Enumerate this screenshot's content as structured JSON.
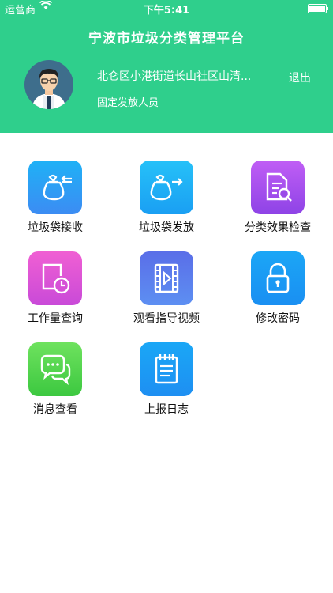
{
  "status": {
    "carrier": "运营商",
    "time": "下午5:41"
  },
  "header": {
    "title": "宁波市垃圾分类管理平台",
    "address": "北仑区小港街道长山社区山清...",
    "role": "固定发放人员",
    "logout": "退出"
  },
  "colors": {
    "header": "#2fcf8c"
  },
  "menu": {
    "items": [
      {
        "label": "垃圾袋接收",
        "icon": "bag-receive-icon"
      },
      {
        "label": "垃圾袋发放",
        "icon": "bag-dispatch-icon"
      },
      {
        "label": "分类效果检查",
        "icon": "document-search-icon"
      },
      {
        "label": "工作量查询",
        "icon": "clock-document-icon"
      },
      {
        "label": "观看指导视频",
        "icon": "video-icon"
      },
      {
        "label": "修改密码",
        "icon": "lock-icon"
      },
      {
        "label": "消息查看",
        "icon": "chat-icon"
      },
      {
        "label": "上报日志",
        "icon": "notepad-icon"
      }
    ]
  }
}
